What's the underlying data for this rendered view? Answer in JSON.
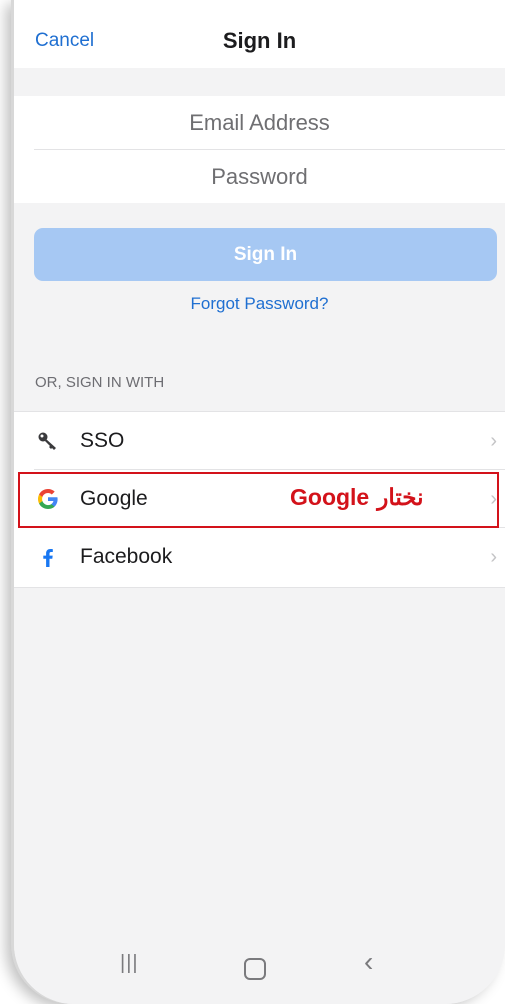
{
  "header": {
    "cancel_label": "Cancel",
    "title": "Sign In"
  },
  "form": {
    "email_placeholder": "Email Address",
    "password_placeholder": "Password",
    "signin_label": "Sign In",
    "forgot_label": "Forgot Password?"
  },
  "alt_signin": {
    "section_label": "OR, SIGN IN WITH",
    "providers": [
      {
        "label": "SSO",
        "icon": "key-icon"
      },
      {
        "label": "Google",
        "icon": "google-icon"
      },
      {
        "label": "Facebook",
        "icon": "facebook-icon"
      }
    ],
    "chevron": "›"
  },
  "annotation": {
    "arabic": "نختار",
    "latin": "Google",
    "color": "#d3121a"
  },
  "nav": {
    "recent_glyph": "|||",
    "back_glyph": "‹"
  },
  "colors": {
    "accent": "#1f6fd1",
    "signin_button": "#a6c8f3",
    "background": "#f3f3f4"
  }
}
